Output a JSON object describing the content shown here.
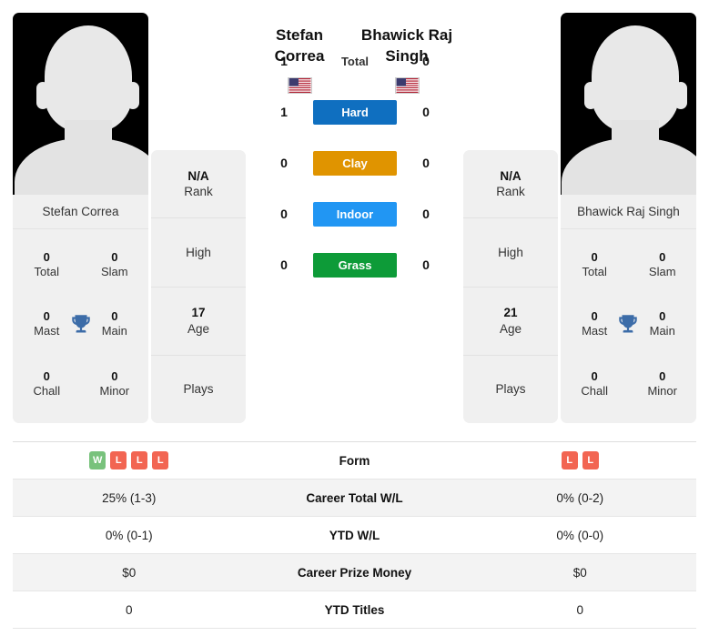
{
  "players": {
    "left": {
      "name": "Stefan Correa",
      "name_line1": "Stefan",
      "name_line2": "Correa",
      "flag": "us-flag-icon",
      "avatar": "player-silhouette-icon",
      "rank_value": "N/A",
      "rank_label": "Rank",
      "high_label": "High",
      "age_value": "17",
      "age_label": "Age",
      "plays_label": "Plays",
      "titles": [
        {
          "num": "0",
          "lbl": "Total"
        },
        {
          "num": "0",
          "lbl": "Slam"
        },
        {
          "num": "0",
          "lbl": "Mast"
        },
        {
          "num": "0",
          "lbl": "Main"
        },
        {
          "num": "0",
          "lbl": "Chall"
        },
        {
          "num": "0",
          "lbl": "Minor"
        }
      ]
    },
    "right": {
      "name": "Bhawick Raj Singh",
      "name_line1": "Bhawick Raj",
      "name_line2": "Singh",
      "flag": "us-flag-icon",
      "avatar": "player-silhouette-icon",
      "rank_value": "N/A",
      "rank_label": "Rank",
      "high_label": "High",
      "age_value": "21",
      "age_label": "Age",
      "plays_label": "Plays",
      "titles": [
        {
          "num": "0",
          "lbl": "Total"
        },
        {
          "num": "0",
          "lbl": "Slam"
        },
        {
          "num": "0",
          "lbl": "Mast"
        },
        {
          "num": "0",
          "lbl": "Main"
        },
        {
          "num": "0",
          "lbl": "Chall"
        },
        {
          "num": "0",
          "lbl": "Minor"
        }
      ]
    }
  },
  "head_to_head": [
    {
      "label": "Total",
      "left": "1",
      "right": "0",
      "color": "",
      "pill": false
    },
    {
      "label": "Hard",
      "left": "1",
      "right": "0",
      "color": "#0f6fc0",
      "pill": true
    },
    {
      "label": "Clay",
      "left": "0",
      "right": "0",
      "color": "#e09400",
      "pill": true
    },
    {
      "label": "Indoor",
      "left": "0",
      "right": "0",
      "color": "#2196f3",
      "pill": true
    },
    {
      "label": "Grass",
      "left": "0",
      "right": "0",
      "color": "#0d9b38",
      "pill": true
    }
  ],
  "stats_rows": [
    {
      "label": "Form",
      "type": "form",
      "left_form": [
        "W",
        "L",
        "L",
        "L"
      ],
      "right_form": [
        "L",
        "L"
      ],
      "left": "",
      "right": ""
    },
    {
      "label": "Career Total W/L",
      "type": "text",
      "left": "25% (1-3)",
      "right": "0% (0-2)"
    },
    {
      "label": "YTD W/L",
      "type": "text",
      "left": "0% (0-1)",
      "right": "0% (0-0)"
    },
    {
      "label": "Career Prize Money",
      "type": "text",
      "left": "$0",
      "right": "$0"
    },
    {
      "label": "YTD Titles",
      "type": "text",
      "left": "0",
      "right": "0"
    }
  ],
  "colors": {
    "hard": "#0f6fc0",
    "clay": "#e09400",
    "indoor": "#2196f3",
    "grass": "#0d9b38",
    "win_badge": "#78c27c",
    "loss_badge": "#f26552",
    "trophy": "#3c6ca8",
    "panel_bg": "#f0f0f0"
  }
}
